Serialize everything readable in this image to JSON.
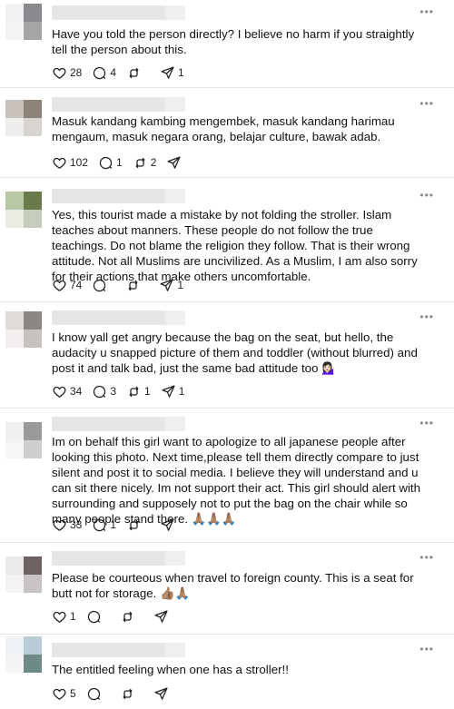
{
  "icons": {
    "more": "more-dots-icon",
    "like": "heart-icon",
    "reply": "comment-icon",
    "repost": "repost-icon",
    "share": "share-icon"
  },
  "colors": {
    "divider": "#e3e3e3",
    "text": "#101010",
    "icon": "#222222"
  },
  "more_label": "•••",
  "posts": [
    {
      "text": "Have you told the person directly? I believe no harm if you straightly tell the person about this.",
      "likes": "28",
      "replies": "4",
      "reposts": "",
      "shares": "1"
    },
    {
      "text": "Masuk kandang kambing mengembek, masuk kandang harimau mengaum, masuk negara orang, belajar culture, bawak adab.",
      "likes": "102",
      "replies": "1",
      "reposts": "2",
      "shares": ""
    },
    {
      "text": "Yes, this tourist made a mistake by not folding the stroller. Islam teaches about manners. These people do not follow the true teachings. Do not blame the religion they follow. That is their wrong attitude. Not all Muslims are uncivilized. As a Muslim, I am also sorry for their actions that make others uncomfortable.",
      "likes": "74",
      "replies": "",
      "reposts": "",
      "shares": "1"
    },
    {
      "text": "I know yall get angry because the bag on the seat, but hello, the audacity u snapped picture of them and toddler (without blurred) and post it and talk bad, just the same bad attitude too 💁🏻‍♀️",
      "likes": "34",
      "replies": "3",
      "reposts": "1",
      "shares": "1"
    },
    {
      "text": "Im on behalf this girl want to apologize to all japanese people after looking this photo. Next time,please tell them directly compare to just silent and post it to social media. I believe they will understand and u can sit there nicely. Im not support their act. This girl should alert with surrounding and supposely not to put the bag on the chair while so many people stand there. 🙏🏽🙏🏽🙏🏽",
      "likes": "33",
      "replies": "1",
      "reposts": "",
      "shares": ""
    },
    {
      "text": "Please be courteous when travel to foreign county. This is a seat for butt not for storage. 👍🏽🙏🏽",
      "likes": "1",
      "replies": "",
      "reposts": "",
      "shares": ""
    },
    {
      "text": "The entitled feeling when one has a stroller!!",
      "likes": "5",
      "replies": "",
      "reposts": "",
      "shares": ""
    }
  ]
}
